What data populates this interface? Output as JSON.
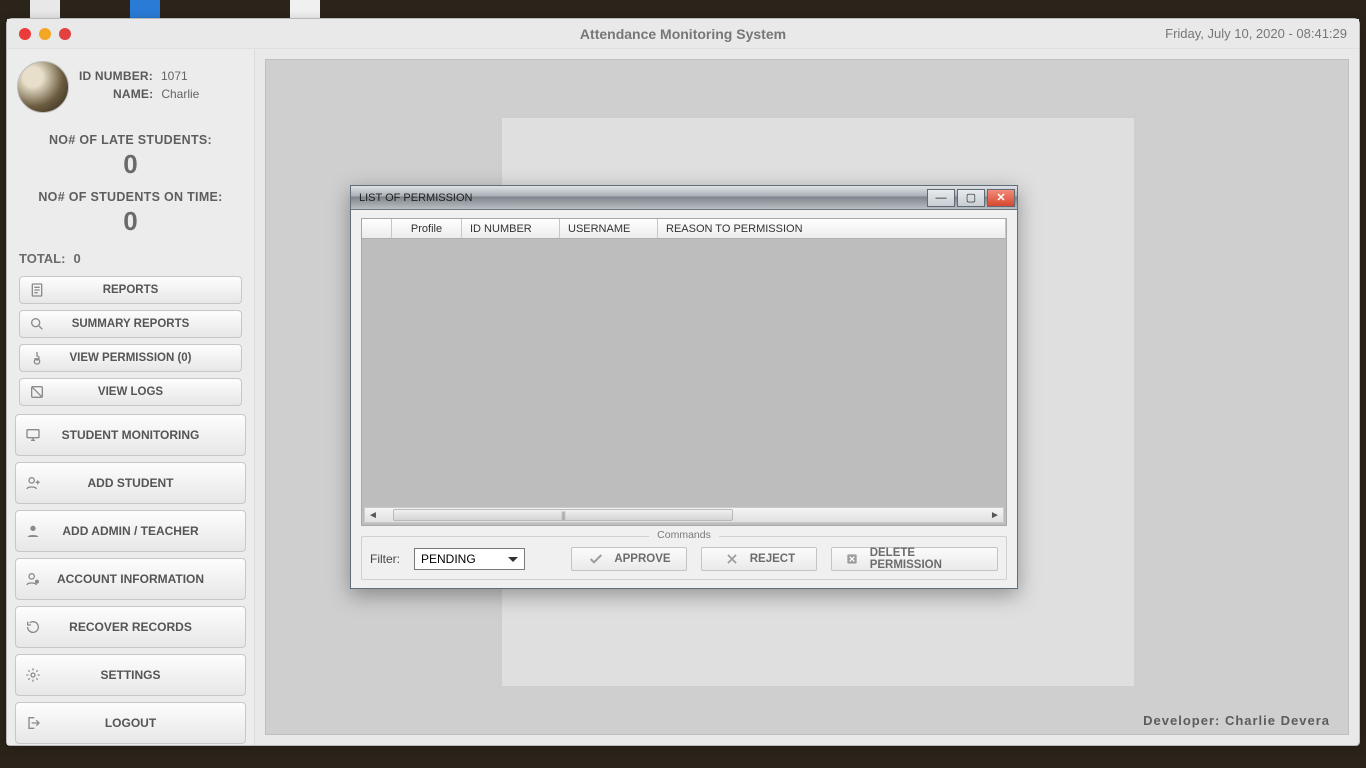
{
  "app": {
    "title": "Attendance Monitoring System",
    "datetime": "Friday, July  10, 2020 - 08:41:29",
    "developer": "Developer: Charlie Devera"
  },
  "profile": {
    "id_label": "ID NUMBER:",
    "id_value": "1071",
    "name_label": "NAME:",
    "name_value": "Charlie"
  },
  "stats": {
    "late_label": "NO# OF LATE STUDENTS:",
    "late_value": "0",
    "ontime_label": "NO# OF STUDENTS ON TIME:",
    "ontime_value": "0",
    "total_label": "TOTAL:",
    "total_value": "0"
  },
  "sidebar": {
    "reports": "REPORTS",
    "summary_reports": "SUMMARY REPORTS",
    "view_permission": "VIEW PERMISSION (0)",
    "view_logs": "VIEW LOGS",
    "student_monitoring": "STUDENT MONITORING",
    "add_student": "ADD STUDENT",
    "add_admin": "ADD ADMIN / TEACHER",
    "account_info": "ACCOUNT INFORMATION",
    "recover": "RECOVER RECORDS",
    "settings": "SETTINGS",
    "logout": "LOGOUT"
  },
  "dialog": {
    "title": "LIST OF PERMISSION",
    "columns": {
      "profile": "Profile",
      "id_number": "ID NUMBER",
      "username": "USERNAME",
      "reason": "REASON TO PERMISSION"
    },
    "commands_legend": "Commands",
    "filter_label": "Filter:",
    "filter_value": "PENDING",
    "approve": "APPROVE",
    "reject": "REJECT",
    "delete": "DELETE PERMISSION"
  }
}
